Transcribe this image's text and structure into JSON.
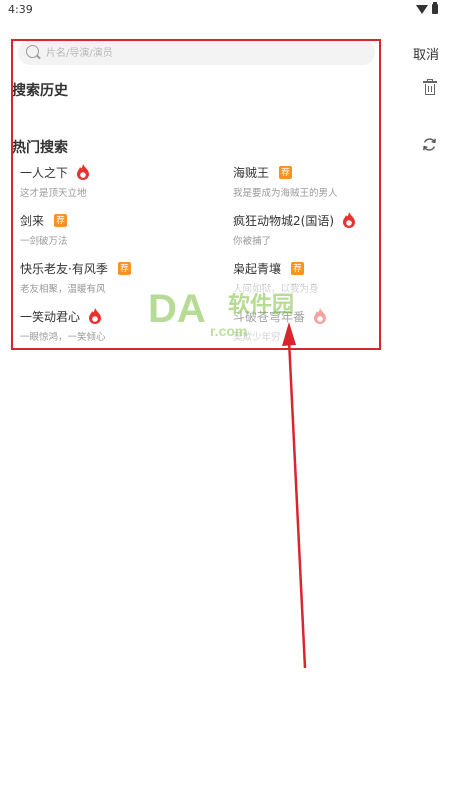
{
  "status_bar": {
    "time": "4:39"
  },
  "search": {
    "placeholder": "片名/导演/演员",
    "value": "",
    "cancel_label": "取消"
  },
  "history": {
    "title": "搜索历史"
  },
  "hot": {
    "title": "热门搜索",
    "items": [
      {
        "name": "一人之下",
        "desc": "这才是顶天立地",
        "badge": "hot"
      },
      {
        "name": "海贼王",
        "desc": "我是要成为海贼王的男人",
        "badge": "rec",
        "badge_text": "荐"
      },
      {
        "name": "剑来",
        "desc": "一剑破万法",
        "badge": "rec",
        "badge_text": "荐"
      },
      {
        "name": "疯狂动物城2(国语)",
        "desc": "你被捕了",
        "badge": "hot"
      },
      {
        "name": "快乐老友·有风季",
        "desc": "老友相聚，温暖有风",
        "badge": "rec",
        "badge_text": "荐"
      },
      {
        "name": "枭起青壤",
        "desc": "人间如狱，以我为身",
        "badge": "rec",
        "badge_text": "荐"
      },
      {
        "name": "一笑动君心",
        "desc": "一眼惊鸿，一笑倾心",
        "badge": "hot"
      },
      {
        "name": "斗破苍穹年番",
        "desc": "莫欺少年穷",
        "badge": "hot"
      }
    ]
  },
  "watermark": {
    "logo": "DA",
    "name": "软件园",
    "url": "r.com"
  },
  "colors": {
    "annotation": "#d9262e",
    "hot_badge": "#e8322e",
    "rec_badge": "#f7931e"
  },
  "icons": {
    "search": "search-icon",
    "trash": "trash-icon",
    "refresh": "refresh-icon",
    "hot": "flame-hot-icon"
  }
}
